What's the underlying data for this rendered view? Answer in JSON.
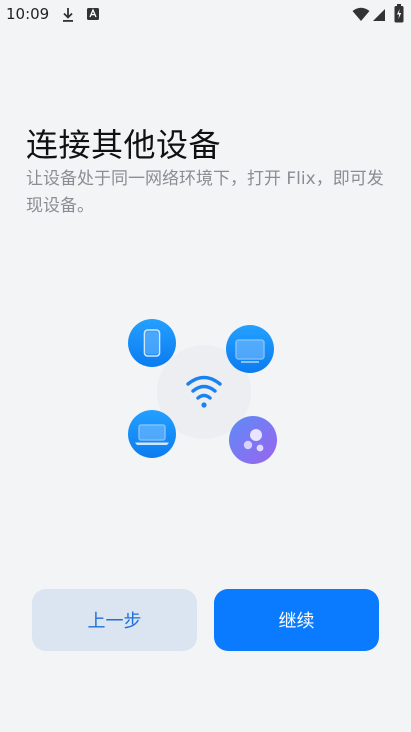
{
  "status_bar": {
    "time": "10:09",
    "left_icons": [
      "download-icon",
      "a-notification-icon"
    ],
    "right_icons": [
      "wifi-icon",
      "signal-icon",
      "battery-icon"
    ]
  },
  "page": {
    "title": "连接其他设备",
    "subtitle": "让设备处于同一网络环境下，打开 Flix，即可发现设备。"
  },
  "illustration": {
    "center_icon": "wifi-icon",
    "device_icons": [
      "phone-icon",
      "tablet-icon",
      "laptop-icon",
      "apps-icon"
    ],
    "colors": {
      "blue": "#1590f5",
      "purple": "#8a6cf0",
      "center": "#eceef1",
      "wifi": "#1a82f0"
    }
  },
  "buttons": {
    "prev_label": "上一步",
    "continue_label": "继续"
  },
  "colors": {
    "background": "#f3f4f6",
    "primary": "#0a7bff",
    "secondary_bg": "#dbe5f1"
  }
}
